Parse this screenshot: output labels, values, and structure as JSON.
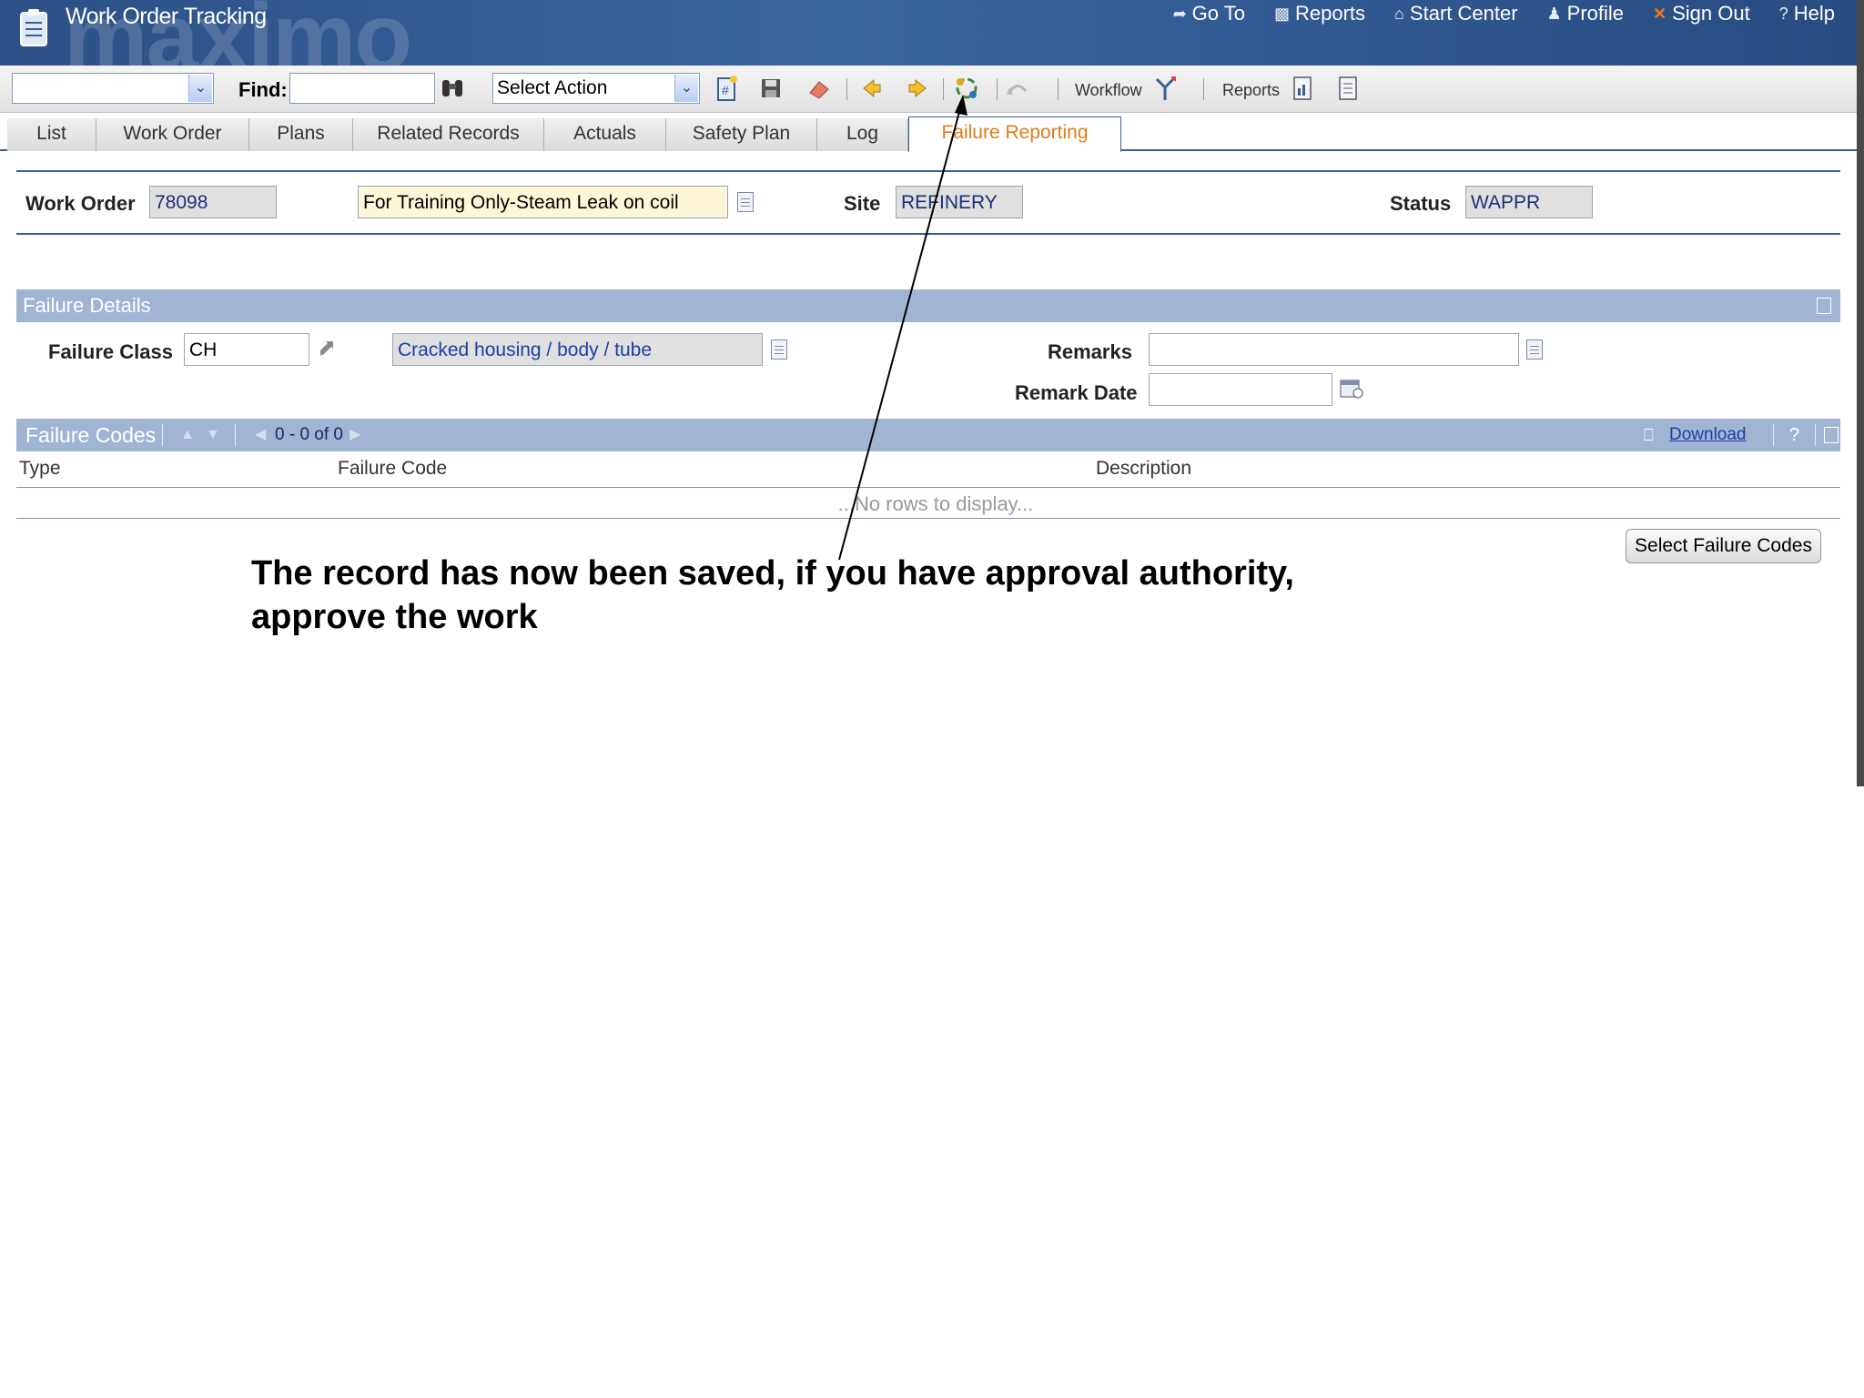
{
  "app": {
    "title": "Work Order Tracking",
    "brand_watermark": "maximo"
  },
  "top_nav": [
    {
      "label": "Go To",
      "icon": "goto-arrow-icon"
    },
    {
      "label": "Reports",
      "icon": "bar-chart-icon"
    },
    {
      "label": "Start Center",
      "icon": "home-icon"
    },
    {
      "label": "Profile",
      "icon": "person-icon"
    },
    {
      "label": "Sign Out",
      "icon": "x-icon"
    },
    {
      "label": "Help",
      "icon": "question-icon"
    }
  ],
  "toolbar": {
    "find_label": "Find:",
    "find_value": "",
    "action_select": "Select Action",
    "workflow_label": "Workflow",
    "reports_label": "Reports"
  },
  "tabs": [
    "List",
    "Work Order",
    "Plans",
    "Related Records",
    "Actuals",
    "Safety Plan",
    "Log",
    "Failure Reporting"
  ],
  "active_tab": "Failure Reporting",
  "work_order": {
    "wo_label": "Work Order",
    "wo_value": "78098",
    "description": "For Training Only-Steam Leak on coil",
    "site_label": "Site",
    "site_value": "REFINERY",
    "status_label": "Status",
    "status_value": "WAPPR"
  },
  "failure_details": {
    "title": "Failure Details",
    "class_label": "Failure Class",
    "class_value": "CH",
    "class_description": "Cracked housing / body / tube",
    "remarks_label": "Remarks",
    "remarks_value": "",
    "remark_date_label": "Remark Date",
    "remark_date_value": ""
  },
  "failure_codes": {
    "title": "Failure Codes",
    "pagination": "0 - 0 of 0",
    "download_label": "Download",
    "help_glyph": "?",
    "columns": [
      "Type",
      "Failure Code",
      "Description"
    ],
    "empty_text": "...No rows to display...",
    "select_button": "Select Failure Codes"
  },
  "annotation": {
    "text": "The record has now been saved, if you have approval authority, approve the work"
  }
}
